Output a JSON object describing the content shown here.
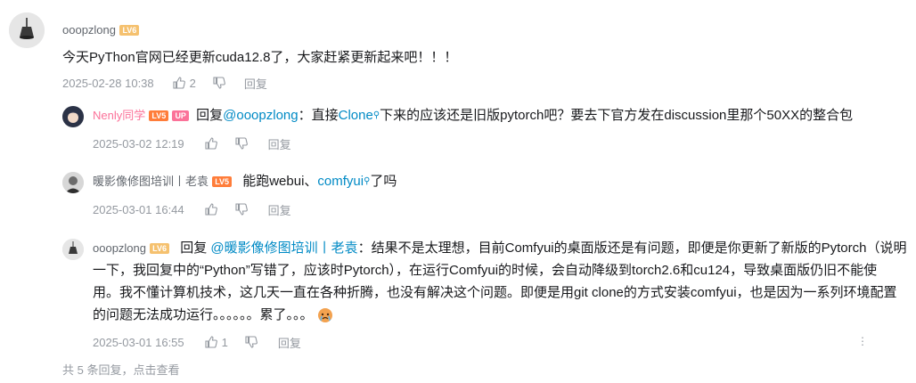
{
  "main_comment": {
    "username": "ooopzlong",
    "level": "LV6",
    "text": "今天PyThon官网已经更新cuda12.8了，大家赶紧更新起来吧！！！",
    "date": "2025-02-28 10:38",
    "likes": "2",
    "reply_label": "回复"
  },
  "replies": [
    {
      "username": "Nenly同学",
      "level": "LV5",
      "badge": "UP",
      "reply_prefix": "回复",
      "mention": "@ooopzlong",
      "colon": "：直接",
      "keyword": "Clone",
      "text_after": "下来的应该还是旧版pytorch吧？要去下官方发在discussion里那个50XX的整合包",
      "date": "2025-03-02 12:19",
      "reply_label": "回复"
    },
    {
      "username": "暖影像修图培训丨老袁",
      "level": "LV5",
      "text_before": "能跑webui、",
      "keyword": "comfyui",
      "text_after": "了吗",
      "date": "2025-03-01 16:44",
      "reply_label": "回复"
    },
    {
      "username": "ooopzlong",
      "level": "LV6",
      "reply_prefix": "回复",
      "mention": "@暖影像修图培训丨老袁",
      "line1_rest": "：结果不是太理想，目前Comfyui的桌面版还是有问题，即便是你更新了新版的Pytorch（说明",
      "line2": "一下，我回复中的“Python”写错了，应该时Pytorch），在运行Comfyui的时候，会自动降级到torch2.6和cu124，导致桌面版仍旧不能使",
      "line3": "用。我不懂计算机技术，这几天一直在各种折腾，也没有解决这个问题。即便是用git clone的方式安装comfyui，也是因为一系列环境配置",
      "line4": "的问题无法成功运行。。。。。。累了。。。",
      "date": "2025-03-01 16:55",
      "likes": "1",
      "reply_label": "回复"
    }
  ],
  "footer": {
    "text": "共 5 条回复，点击查看"
  },
  "colors": {
    "link": "#008ac5",
    "meta": "#9499a0",
    "up_badge": "#fb7299"
  }
}
